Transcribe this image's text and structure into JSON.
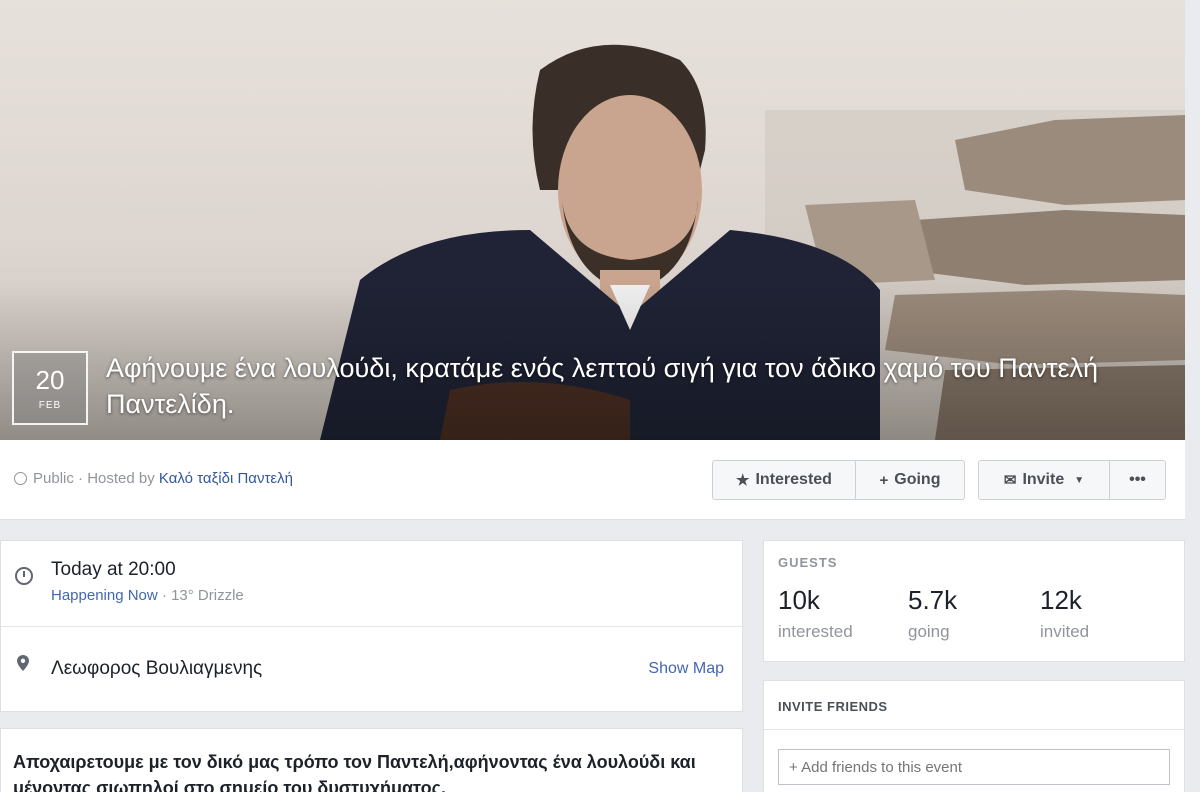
{
  "event": {
    "date_day": "20",
    "date_month": "FEB",
    "title": "Αφήνουμε ένα λουλούδι, κρατάμε ενός λεπτού σιγή για τον άδικο χαμό του Παντελή Παντελίδη."
  },
  "host": {
    "privacy": "Public",
    "hosted_by_prefix": " · Hosted by ",
    "host_name": "Καλό ταξίδι Παντελή"
  },
  "actions": {
    "interested": "Interested",
    "going": "Going",
    "invite": "Invite",
    "more": "•••"
  },
  "details": {
    "time_main": "Today at 20:00",
    "happening": "Happening Now",
    "weather": " · 13° Drizzle",
    "location": "Λεωφορος Βουλιαγμενης",
    "show_map": "Show Map"
  },
  "description": {
    "text": "Αποχαιρετουμε με τον δικό μας τρόπο τον Παντελή,αφήνοντας ένα λουλούδι και μένοντας σιωπηλοί στο σημείο του δυστυχήματος."
  },
  "guests": {
    "heading": "GUESTS",
    "stats": [
      {
        "num": "10k",
        "label": "interested"
      },
      {
        "num": "5.7k",
        "label": "going"
      },
      {
        "num": "12k",
        "label": "invited"
      }
    ]
  },
  "invite_friends": {
    "heading": "INVITE FRIENDS",
    "placeholder": "+ Add friends to this event"
  }
}
